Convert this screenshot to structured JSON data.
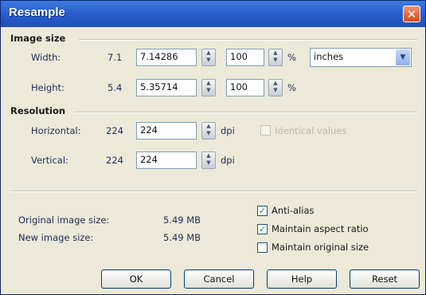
{
  "window": {
    "title": "Resample",
    "close_glyph": "✕"
  },
  "image_size": {
    "group_label": "Image size",
    "width": {
      "label": "Width:",
      "original": "7.1",
      "value": "7.14286",
      "percent": "100"
    },
    "height": {
      "label": "Height:",
      "original": "5.4",
      "value": "5.35714",
      "percent": "100"
    },
    "percent_symbol": "%",
    "unit": "inches"
  },
  "resolution": {
    "group_label": "Resolution",
    "horizontal": {
      "label": "Horizontal:",
      "original": "224",
      "value": "224",
      "unit": "dpi"
    },
    "vertical": {
      "label": "Vertical:",
      "original": "224",
      "value": "224",
      "unit": "dpi"
    },
    "identical_values": {
      "label": "Identical values",
      "checked": false,
      "enabled": false
    }
  },
  "info": {
    "original_label": "Original image size:",
    "original_value": "5.49 MB",
    "new_label": "New image size:",
    "new_value": "5.49 MB"
  },
  "options": {
    "anti_alias": {
      "label": "Anti-alias",
      "checked": true
    },
    "maintain_aspect": {
      "label": "Maintain aspect ratio",
      "checked": true
    },
    "maintain_original": {
      "label": "Maintain original size",
      "checked": false
    }
  },
  "buttons": {
    "ok": "OK",
    "cancel": "Cancel",
    "help": "Help",
    "reset": "Reset"
  },
  "icons": {
    "spin": "spin-updown-icon",
    "dropdown": "chevron-down-icon",
    "check": "checkmark-icon"
  },
  "colors": {
    "titlebar": "#2b5fcf",
    "close": "#d84a20",
    "dialog_bg": "#ece9d8"
  }
}
